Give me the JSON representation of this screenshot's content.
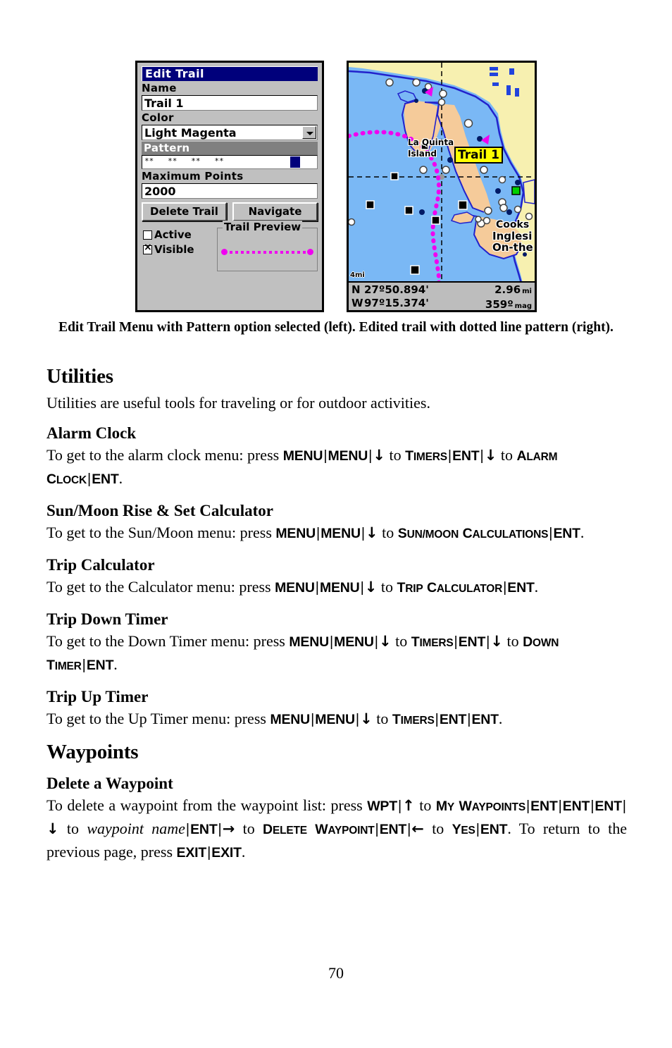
{
  "figure": {
    "gps_menu": {
      "title": "Edit Trail",
      "name_label": "Name",
      "name_value": "Trail 1",
      "color_label": "Color",
      "color_value": "Light Magenta",
      "pattern_label": "Pattern",
      "pattern_value": "**   **   **   **",
      "max_points_label": "Maximum Points",
      "max_points_value": "2000",
      "delete_button": "Delete Trail",
      "navigate_button": "Navigate",
      "active_label": "Active",
      "active_checked": "false",
      "visible_label": "Visible",
      "visible_checked": "true",
      "trail_preview_label": "Trail Preview",
      "accent_blue": "#00007b",
      "trail_color": "#f000f0"
    },
    "gps_map": {
      "trail_label": "Trail 1",
      "scale": "4mi",
      "place_1": "La Quinta",
      "place_2": "Island",
      "place_3": "Cooks",
      "place_4": "Inglesi",
      "place_5": "On-the",
      "lat_hemi": "N",
      "lat_value": "27º50.894'",
      "lon_hemi": "W",
      "lon_value": "97º15.374'",
      "dist_value": "2.96",
      "dist_unit": "mi",
      "bearing_value": "359º",
      "bearing_unit": "mag",
      "water_color": "#7ab8f5",
      "land_color": "#f4e6a8",
      "island_color": "#f5cb9a",
      "highlight_color": "#ffff00"
    },
    "caption_line_1": "Edit Trail Menu with Pattern option selected (left). Edited trail with",
    "caption_line_2": "dotted line pattern (right)."
  },
  "content": {
    "utilities_heading": "Utilities",
    "utilities_intro": "Utilities are useful tools for traveling or for outdoor activities.",
    "alarm_clock": {
      "heading": "Alarm Clock",
      "t1": "To get to the alarm clock menu: press ",
      "k_menu1": "MENU",
      "k_menu2": "MENU",
      "arrow_down": "↓",
      "t2": " to ",
      "sc_timers_cap": "T",
      "sc_timers_rest": "IMERS",
      "k_ent1": "ENT",
      "arrow_down2": "↓",
      "t3": "to ",
      "sc_alarm_cap1": "A",
      "sc_alarm_rest1": "LARM",
      "sc_alarm_cap2": "C",
      "sc_alarm_rest2": "LOCK",
      "k_ent2": "ENT",
      "period": "."
    },
    "sunmoon": {
      "heading": "Sun/Moon Rise & Set Calculator",
      "t1": "To get to the Sun/Moon menu: press ",
      "k_menu1": "MENU",
      "k_menu2": "MENU",
      "t2": " to ",
      "sc_cap1": "S",
      "sc_rest1": "UN/M",
      "sc_cap2": "",
      "sc_rest2": "OON",
      "sc_calc_cap": "C",
      "sc_calc_rest": "ALCULATIONS",
      "k_ent": "ENT"
    },
    "trip_calc": {
      "heading": "Trip Calculator",
      "t1": "To get to the Calculator menu: press ",
      "k_menu1": "MENU",
      "k_menu2": "MENU",
      "t2": " to ",
      "sc_trip_cap": "T",
      "sc_trip_rest": "RIP",
      "sc_calc_cap": "C",
      "sc_calc_rest": "ALCULATOR",
      "k_ent": "ENT"
    },
    "trip_down": {
      "heading": "Trip Down Timer",
      "t1": "To get to the Down Timer menu: press ",
      "k_menu1": "MENU",
      "k_menu2": "MENU",
      "t2": " to ",
      "sc_timers_cap": "T",
      "sc_timers_rest": "IMERS",
      "k_ent1": "ENT",
      "t3": "to ",
      "sc_down_cap": "D",
      "sc_down_rest": "OWN",
      "sc_timer_cap": "T",
      "sc_timer_rest": "IMER",
      "k_ent2": "ENT"
    },
    "trip_up": {
      "heading": "Trip Up Timer",
      "t1": "To get to the Up Timer menu: press ",
      "k_menu1": "MENU",
      "k_menu2": "MENU",
      "t2": " to ",
      "sc_timers_cap": "T",
      "sc_timers_rest": "IMERS",
      "k_ent1": "ENT",
      "k_ent2": "ENT"
    },
    "waypoints_heading": "Waypoints",
    "delete_waypoint": {
      "heading": "Delete a Waypoint",
      "t1": "To delete a waypoint from the waypoint list: press ",
      "k_wpt": "WPT",
      "arrow_up": "↑",
      "t2": " to ",
      "sc_my_cap": "M",
      "sc_my_rest": "Y",
      "sc_wp_cap": "W",
      "sc_wp_rest": "AYPOINTS",
      "k_ent1": "ENT",
      "k_ent2": "ENT",
      "k_ent3": "ENT",
      "arrow_down": "↓",
      "t3": " to ",
      "italic_wp_name": "waypoint name",
      "k_ent4": "ENT",
      "arrow_right": "→",
      "t4": " to ",
      "sc_del_cap": "D",
      "sc_del_rest": "ELETE",
      "sc_wp2_cap": "W",
      "sc_wp2_rest": "AYPOINT",
      "k_ent5": "ENT",
      "arrow_left": "←",
      "t5": " to ",
      "sc_yes_cap": "Y",
      "sc_yes_rest": "ES",
      "k_ent6": "ENT",
      "t6": ". To return to the previous page, press ",
      "k_exit1": "EXIT",
      "k_exit2": "EXIT",
      "period": "."
    }
  },
  "page_number": "70"
}
